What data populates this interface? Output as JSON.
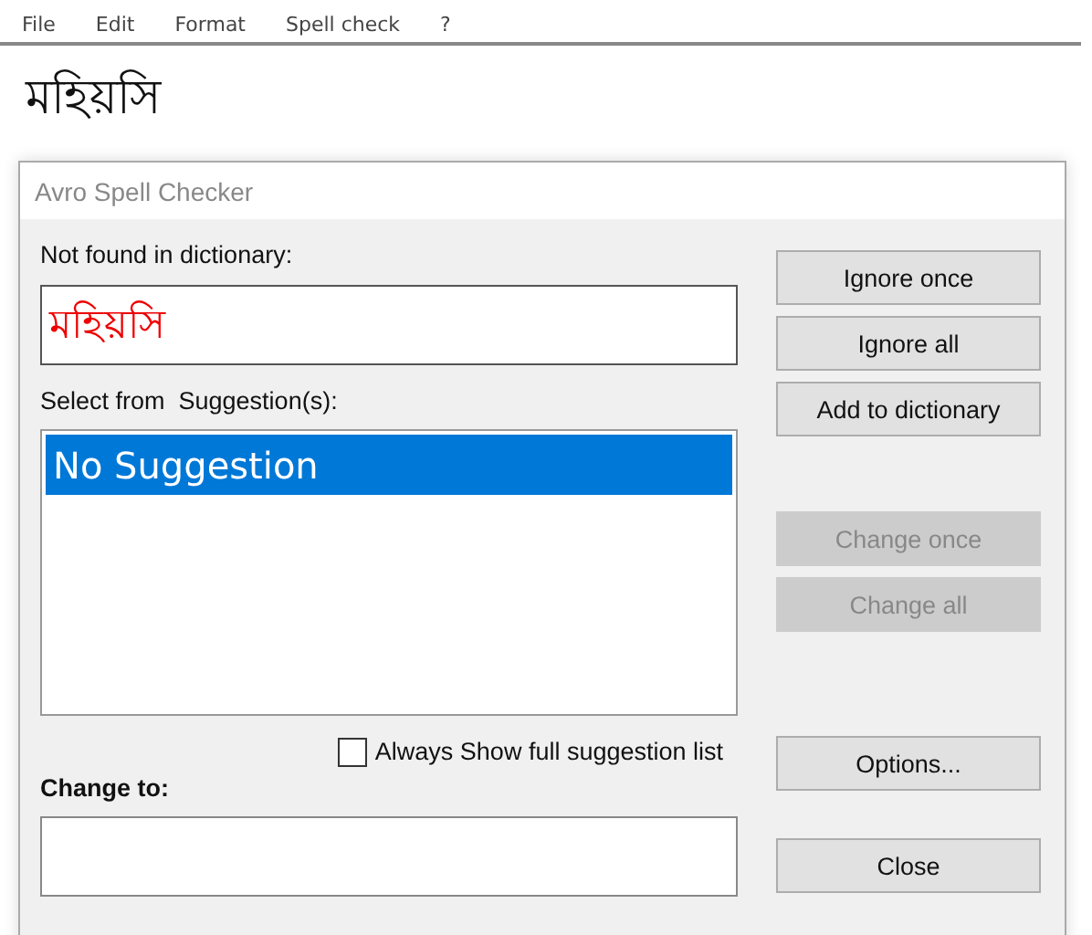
{
  "menu": [
    "File",
    "Edit",
    "Format",
    "Spell check",
    "?"
  ],
  "document_text": "মহিয়সি",
  "dialog": {
    "title": "Avro Spell Checker",
    "not_found_label": "Not found in dictionary:",
    "not_found_word": "মহিয়সি",
    "suggestions_label": "Select from  Suggestion(s):",
    "suggestions": [
      {
        "text": "No Suggestion",
        "selected": true
      }
    ],
    "always_show": {
      "label": "Always Show full suggestion list",
      "checked": false
    },
    "change_to_label": "Change to:",
    "buttons": [
      {
        "label": "Ignore once",
        "disabled": false
      },
      {
        "label": "Ignore all",
        "disabled": false
      },
      {
        "label": "Add to dictionary",
        "disabled": false
      },
      {
        "label": "Change once",
        "disabled": true
      },
      {
        "label": "Change all",
        "disabled": true
      },
      {
        "label": "Options...",
        "disabled": false
      },
      {
        "label": "Close",
        "disabled": false
      }
    ]
  }
}
